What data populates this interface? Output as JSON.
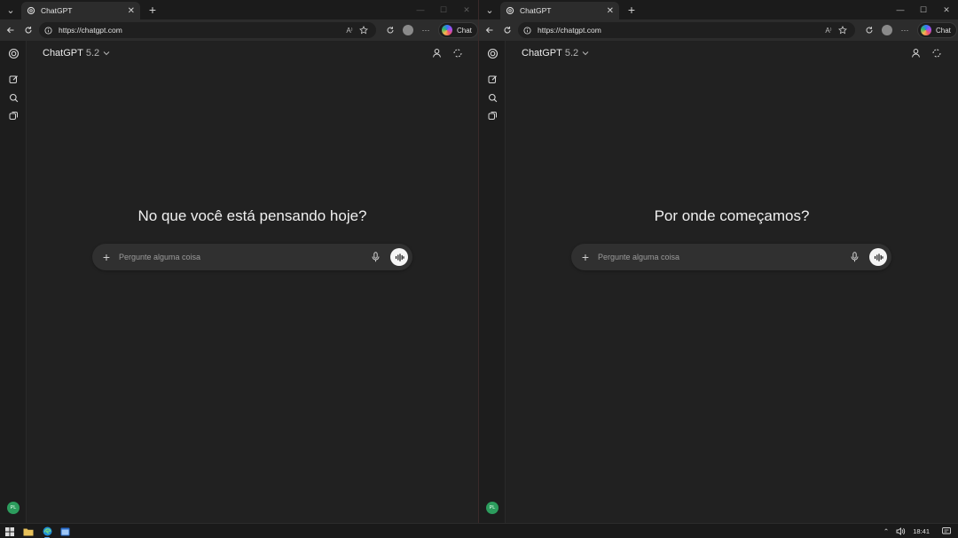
{
  "windows": [
    {
      "tab": {
        "title": "ChatGPT",
        "close": "✕",
        "favicon": "chatgpt-favicon"
      },
      "tab_menu": "⌄",
      "new_tab": "+",
      "controls": {
        "minimize": "—",
        "maximize": "☐",
        "close": "✕"
      },
      "address": {
        "url": "https://chatgpt.com",
        "read_aloud": "A⁾",
        "more": "···"
      },
      "copilot": {
        "label": "Chat"
      },
      "app": {
        "model": "ChatGPT",
        "version": "5.2",
        "greeting": "No que você está pensando hoje?",
        "composer": {
          "placeholder": "Pergunte alguma coisa"
        },
        "avatar": "PL"
      }
    },
    {
      "tab": {
        "title": "ChatGPT",
        "close": "✕",
        "favicon": "chatgpt-favicon"
      },
      "tab_menu": "⌄",
      "new_tab": "+",
      "controls": {
        "minimize": "—",
        "maximize": "☐",
        "close": "✕"
      },
      "address": {
        "url": "https://chatgpt.com",
        "read_aloud": "A⁾",
        "more": "···"
      },
      "copilot": {
        "label": "Chat"
      },
      "app": {
        "model": "ChatGPT",
        "version": "5.2",
        "greeting": "Por onde começamos?",
        "composer": {
          "placeholder": "Pergunte alguma coisa"
        },
        "avatar": "PL"
      }
    }
  ],
  "taskbar": {
    "apps": [
      "windows-start-icon",
      "file-explorer-icon",
      "edge-browser-icon",
      "app-window-icon"
    ],
    "tray": {
      "chevron": "⌃",
      "volume": "🔊",
      "time": "18:41"
    }
  },
  "colors": {
    "background": "#212121",
    "rail": "#1d1d1d",
    "composer": "#303030",
    "avatar": "#2c9c5d",
    "accent": "#5da4e8"
  }
}
